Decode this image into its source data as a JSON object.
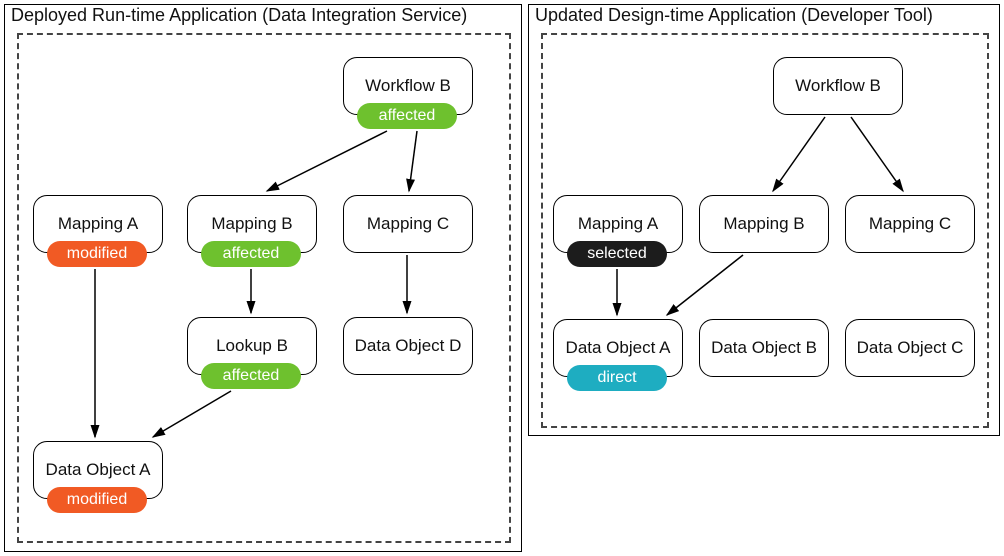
{
  "left": {
    "title": "Deployed Run-time Application (Data Integration Service)",
    "nodes": {
      "workflowB": "Workflow B",
      "mappingA": "Mapping A",
      "mappingB": "Mapping B",
      "mappingC": "Mapping C",
      "lookupB": "Lookup B",
      "dataObjectD": "Data Object D",
      "dataObjectA": "Data Object A"
    },
    "tags": {
      "workflowB": "affected",
      "mappingA": "modified",
      "mappingB": "affected",
      "lookupB": "affected",
      "dataObjectA": "modified"
    }
  },
  "right": {
    "title": "Updated Design-time Application (Developer Tool)",
    "nodes": {
      "workflowB": "Workflow B",
      "mappingA": "Mapping A",
      "mappingB": "Mapping B",
      "mappingC": "Mapping C",
      "dataObjectA": "Data Object A",
      "dataObjectB": "Data Object B",
      "dataObjectC": "Data Object C"
    },
    "tags": {
      "mappingA": "selected",
      "dataObjectA": "direct"
    }
  }
}
